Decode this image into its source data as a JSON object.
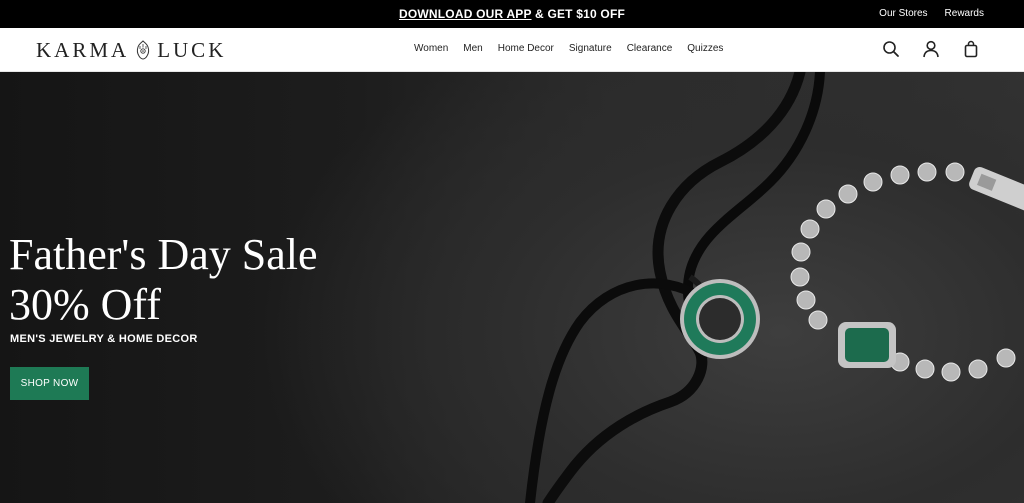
{
  "promo": {
    "link_text": "DOWNLOAD OUR APP",
    "rest_text": " & GET $10 OFF",
    "links": [
      "Our Stores",
      "Rewards"
    ]
  },
  "header": {
    "logo_left": "KARMA",
    "logo_right": "LUCK",
    "nav": [
      "Women",
      "Men",
      "Home Decor",
      "Signature",
      "Clearance",
      "Quizzes"
    ],
    "icons": [
      "search-icon",
      "account-icon",
      "shopping-bag-icon"
    ]
  },
  "hero": {
    "title_line1": "Father's Day Sale",
    "title_line2": "30% Off",
    "subtitle": "MEN'S JEWELRY & HOME DECOR",
    "cta_label": "SHOP NOW",
    "accent_color": "#1e7a55"
  }
}
